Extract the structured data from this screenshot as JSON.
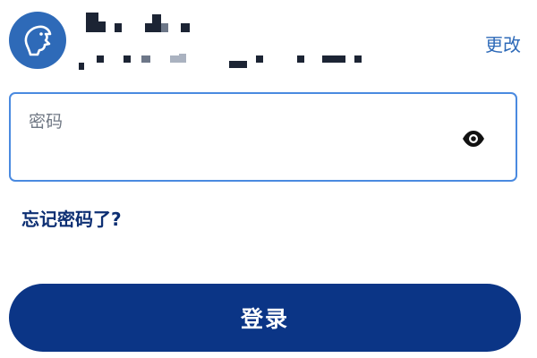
{
  "account": {
    "avatar_icon": "seal-logo-icon",
    "name_masked": "",
    "id_masked": "",
    "change_label": "更改"
  },
  "password": {
    "label": "密码",
    "value": "",
    "eye_icon": "eye-icon"
  },
  "forgot_label": "忘记密码了?",
  "login_label": "登录",
  "colors": {
    "accent": "#2e6ab8",
    "field_border": "#4a8ae0",
    "primary_button": "#0b3586",
    "link_dark": "#0d2f73"
  }
}
